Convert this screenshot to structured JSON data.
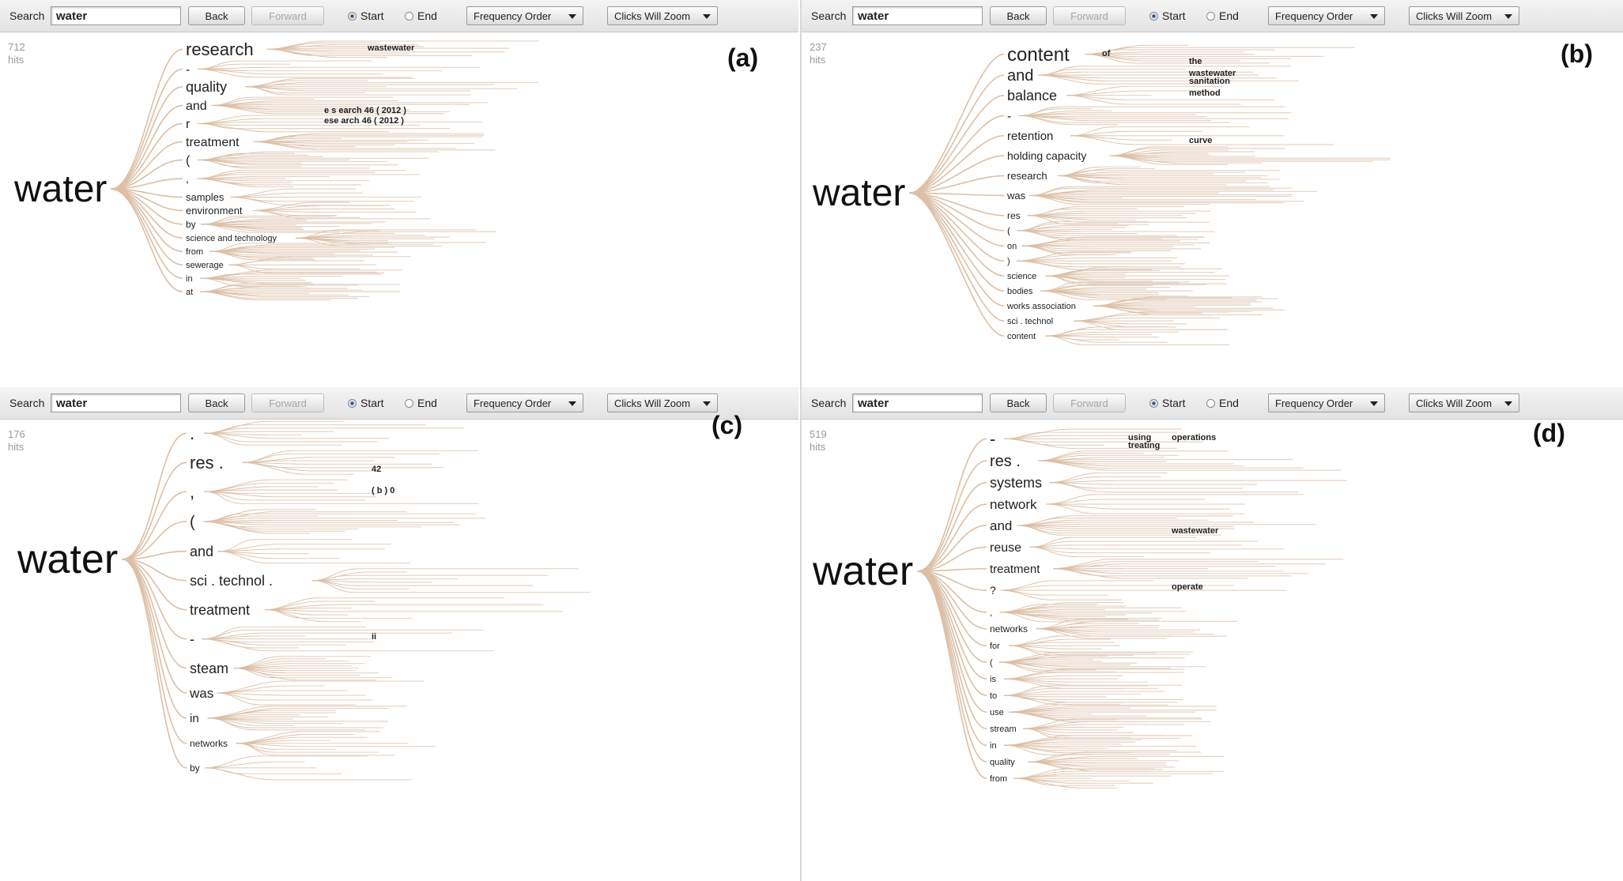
{
  "panels": [
    {
      "id": "a",
      "toolbar": {
        "search_label": "Search",
        "search_value": "water",
        "back": "Back",
        "forward": "Forward",
        "radio_start": "Start",
        "radio_end": "End",
        "order": "Frequency Order",
        "zoom": "Clicks Will Zoom"
      },
      "hits_count": "712",
      "hits_label": "hits",
      "panel_label": "(a)",
      "root": "water",
      "branches": [
        "research",
        "-",
        "quality",
        "and",
        "r",
        "treatment",
        "(",
        ",",
        "samples",
        "environment",
        "by",
        "science and technology",
        "from",
        "sewerage",
        "in",
        "at"
      ],
      "sub_labels": [
        "wastewater",
        "e s earch 46 ( 2012 )",
        "ese arch 46 ( 2012 )"
      ]
    },
    {
      "id": "b",
      "toolbar": {
        "search_label": "Search",
        "search_value": "water",
        "back": "Back",
        "forward": "Forward",
        "radio_start": "Start",
        "radio_end": "End",
        "order": "Frequency Order",
        "zoom": "Clicks Will Zoom"
      },
      "hits_count": "237",
      "hits_label": "hits",
      "panel_label": "(b)",
      "root": "water",
      "branches": [
        "content",
        "and",
        "balance",
        "-",
        "retention",
        "holding capacity",
        "research",
        "was",
        "res",
        "(",
        "on",
        ")",
        "science",
        "bodies",
        "works association",
        "sci . technol",
        "content"
      ],
      "sub_labels": [
        "of",
        "the",
        "wastewater",
        "sanitation",
        "method",
        "curve"
      ]
    },
    {
      "id": "c",
      "toolbar": {
        "search_label": "Search",
        "search_value": "water",
        "back": "Back",
        "forward": "Forward",
        "radio_start": "Start",
        "radio_end": "End",
        "order": "Frequency Order",
        "zoom": "Clicks Will Zoom"
      },
      "hits_count": "176",
      "hits_label": "hits",
      "panel_label": "(c)",
      "root": "water",
      "branches": [
        ".",
        "res .",
        ",",
        "(",
        "and",
        "sci . technol .",
        "treatment",
        "-",
        "steam",
        "was",
        "in",
        "networks",
        "by"
      ],
      "sub_labels": [
        "( b ) 0",
        "42",
        "ii"
      ]
    },
    {
      "id": "d",
      "toolbar": {
        "search_label": "Search",
        "search_value": "water",
        "back": "Back",
        "forward": "Forward",
        "radio_start": "Start",
        "radio_end": "End",
        "order": "Frequency Order",
        "zoom": "Clicks Will Zoom"
      },
      "hits_count": "519",
      "hits_label": "hits",
      "panel_label": "(d)",
      "root": "water",
      "branches": [
        "-",
        "res .",
        "systems",
        "network",
        "and",
        "reuse",
        "treatment",
        "?",
        ",",
        "networks",
        "for",
        "(",
        "is",
        "to",
        "use",
        "stream",
        "in",
        "quality",
        "from"
      ],
      "sub_labels": [
        "using",
        "treating",
        "operations",
        "wastewater",
        "operate"
      ]
    }
  ],
  "colors": {
    "branch": "#dcbfa6",
    "toolbar_bg": "#e8e8e8",
    "root_text": "#111111"
  }
}
